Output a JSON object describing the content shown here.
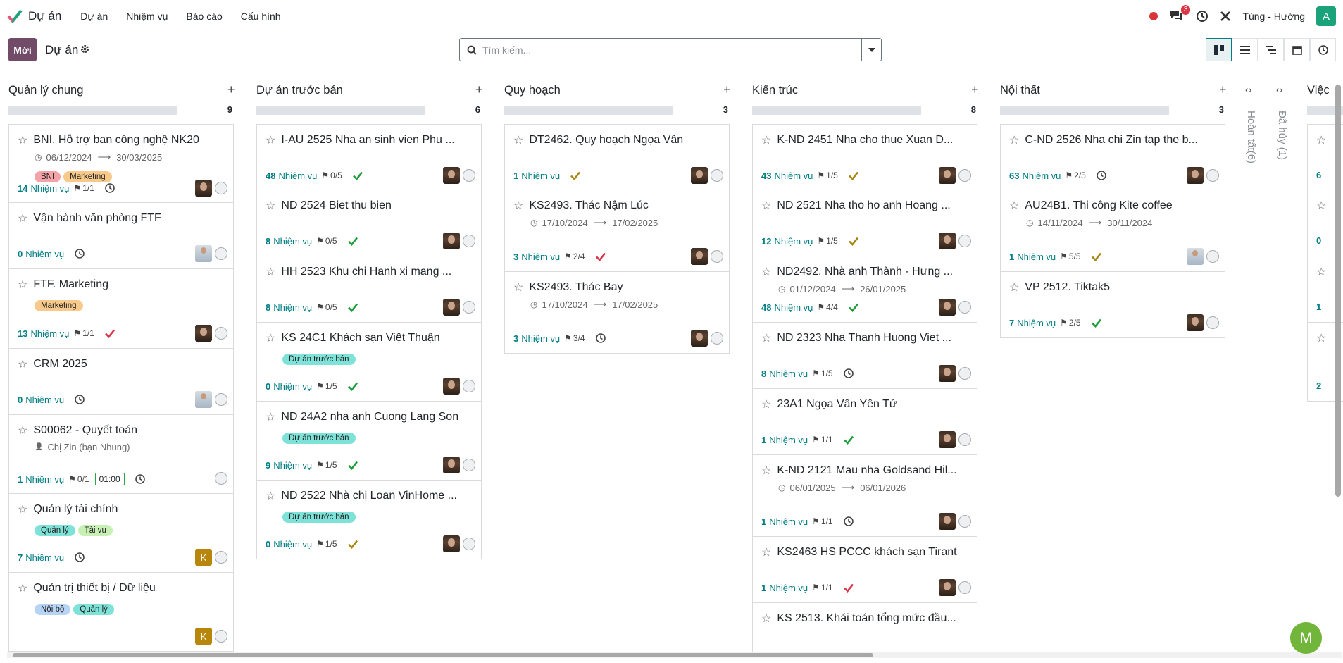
{
  "app": {
    "name": "Dự án",
    "menu": [
      "Dự án",
      "Nhiệm vụ",
      "Báo cáo",
      "Cấu hình"
    ],
    "user": "Tùng - Hường",
    "user_initial": "A",
    "messages_count": "3"
  },
  "control": {
    "new_label": "Mới",
    "breadcrumb": "Dự án",
    "search_placeholder": "Tìm kiếm..."
  },
  "colors": {
    "accent": "#017e84",
    "primary": "#714b67"
  },
  "columns": [
    {
      "title": "Quản lý chung",
      "count": "9",
      "cards": [
        {
          "title": "BNI. Hỗ trợ ban công nghệ NK20",
          "dates": [
            "06/12/2024",
            "30/03/2025"
          ],
          "tags": [
            {
              "label": "BNI",
              "color": "#f4a3a8"
            },
            {
              "label": "Marketing",
              "color": "#f7c98b"
            }
          ],
          "tasks": "14",
          "task_label": "Nhiệm vụ",
          "milestone": "1/1",
          "state": "clock",
          "avatar": "photo",
          "height": 112
        },
        {
          "title": "Vận hành văn phòng FTF",
          "tasks": "0",
          "task_label": "Nhiệm vụ",
          "state": "clock",
          "avatar": "man",
          "height": 94
        },
        {
          "title": "FTF. Marketing",
          "tags": [
            {
              "label": "Marketing",
              "color": "#f7c98b"
            }
          ],
          "tasks": "13",
          "task_label": "Nhiệm vụ",
          "milestone": "1/1",
          "state": "check-red",
          "avatar": "photo",
          "height": 113
        },
        {
          "title": "CRM 2025",
          "tasks": "0",
          "task_label": "Nhiệm vụ",
          "state": "clock",
          "avatar": "man",
          "height": 94
        },
        {
          "title": "S00062 - Quyết toán",
          "partner": "Chị Zin (bạn Nhung)",
          "tasks": "1",
          "task_label": "Nhiệm vụ",
          "milestone": "0/1",
          "timer": "01:00",
          "state": "clock",
          "avatar": "",
          "height": 112
        },
        {
          "title": "Quản lý tài chính",
          "tags": [
            {
              "label": "Quản lý",
              "color": "#7ee2d8"
            },
            {
              "label": "Tài vụ",
              "color": "#c8f0b4"
            }
          ],
          "tasks": "7",
          "task_label": "Nhiệm vụ",
          "state": "clock",
          "avatar": "K",
          "height": 112
        },
        {
          "title": "Quản trị thiết bị / Dữ liệu",
          "tags": [
            {
              "label": "Nội bộ",
              "color": "#b8d4f4"
            },
            {
              "label": "Quản lý",
              "color": "#7ee2d8"
            }
          ],
          "tasks": "",
          "task_label": "",
          "state": "",
          "avatar": "K",
          "height": 112
        }
      ]
    },
    {
      "title": "Dự án trước bán",
      "count": "6",
      "cards": [
        {
          "title": "I-AU 2525 Nha an sinh vien Phu ...",
          "tasks": "48",
          "task_label": "Nhiệm vụ",
          "milestone": "0/5",
          "state": "check-green",
          "avatar": "photo",
          "height": 94
        },
        {
          "title": "ND 2524 Biet thu bien",
          "tasks": "8",
          "task_label": "Nhiệm vụ",
          "milestone": "0/5",
          "state": "check-green",
          "avatar": "photo",
          "height": 94
        },
        {
          "title": "HH 2523 Khu chi Hanh xi mang ...",
          "tasks": "8",
          "task_label": "Nhiệm vụ",
          "milestone": "0/5",
          "state": "check-green",
          "avatar": "photo",
          "height": 94
        },
        {
          "title": "KS 24C1 Khách sạn Việt Thuận",
          "tags": [
            {
              "label": "Dự án trước bán",
              "color": "#7ee2d8"
            }
          ],
          "tasks": "0",
          "task_label": "Nhiệm vụ",
          "milestone": "1/5",
          "state": "check-green",
          "avatar": "photo",
          "height": 112
        },
        {
          "title": "ND 24A2 nha anh Cuong Lang Son",
          "tags": [
            {
              "label": "Dự án trước bán",
              "color": "#7ee2d8"
            }
          ],
          "tasks": "9",
          "task_label": "Nhiệm vụ",
          "milestone": "1/5",
          "state": "check-green",
          "avatar": "photo",
          "height": 112
        },
        {
          "title": "ND 2522 Nhà chị Loan VinHome ...",
          "tags": [
            {
              "label": "Dự án trước bán",
              "color": "#7ee2d8"
            }
          ],
          "tasks": "0",
          "task_label": "Nhiệm vụ",
          "milestone": "1/5",
          "state": "check-olive",
          "avatar": "photo",
          "height": 112
        }
      ]
    },
    {
      "title": "Quy hoạch",
      "count": "3",
      "cards": [
        {
          "title": "DT2462. Quy hoạch Ngọa Vân",
          "tasks": "1",
          "task_label": "Nhiệm vụ",
          "state": "check-olive",
          "avatar": "photo",
          "height": 94
        },
        {
          "title": "KS2493. Thác Nậm Lúc",
          "dates": [
            "17/10/2024",
            "17/02/2025"
          ],
          "tasks": "3",
          "task_label": "Nhiệm vụ",
          "milestone": "2/4",
          "state": "check-red",
          "avatar": "photo",
          "height": 116
        },
        {
          "title": "KS2493. Thác Bay",
          "dates": [
            "17/10/2024",
            "17/02/2025"
          ],
          "tasks": "3",
          "task_label": "Nhiệm vụ",
          "milestone": "3/4",
          "state": "clock",
          "avatar": "photo",
          "height": 116
        }
      ]
    },
    {
      "title": "Kiến trúc",
      "count": "8",
      "cards": [
        {
          "title": "K-ND 2451 Nha cho thue Xuan D...",
          "tasks": "43",
          "task_label": "Nhiệm vụ",
          "milestone": "1/5",
          "state": "check-olive",
          "avatar": "photo",
          "height": 94
        },
        {
          "title": "ND 2521 Nha tho ho anh Hoang ...",
          "tasks": "12",
          "task_label": "Nhiệm vụ",
          "milestone": "1/5",
          "state": "check-olive",
          "avatar": "photo",
          "height": 94
        },
        {
          "title": "ND2492. Nhà anh Thành - Hưng ...",
          "dates": [
            "01/12/2024",
            "26/01/2025"
          ],
          "tasks": "48",
          "task_label": "Nhiệm vụ",
          "milestone": "4/4",
          "state": "check-green",
          "avatar": "photo",
          "height": 94
        },
        {
          "title": "ND 2323 Nha Thanh Huong Viet ...",
          "tasks": "8",
          "task_label": "Nhiệm vụ",
          "milestone": "1/5",
          "state": "clock",
          "avatar": "photo",
          "height": 94
        },
        {
          "title": "23A1 Ngọa Vân Yên Tử",
          "tasks": "1",
          "task_label": "Nhiệm vụ",
          "milestone": "1/1",
          "state": "check-green",
          "avatar": "photo",
          "height": 94
        },
        {
          "title": "K-ND 2121 Mau nha Goldsand Hil...",
          "dates": [
            "06/01/2025",
            "06/01/2026"
          ],
          "tasks": "1",
          "task_label": "Nhiệm vụ",
          "milestone": "1/1",
          "state": "clock",
          "avatar": "photo",
          "height": 116
        },
        {
          "title": "KS2463 HS PCCC khách sạn Tirant",
          "tasks": "1",
          "task_label": "Nhiệm vụ",
          "milestone": "1/1",
          "state": "check-red",
          "avatar": "photo",
          "height": 94
        },
        {
          "title": "KS 2513. Khái toán tổng mức đầu...",
          "tasks": "",
          "task_label": "",
          "state": "",
          "avatar": "",
          "height": 94
        }
      ]
    },
    {
      "title": "Nội thất",
      "count": "3",
      "cards": [
        {
          "title": "C-ND 2526 Nha chi Zin tap the b...",
          "tasks": "63",
          "task_label": "Nhiệm vụ",
          "milestone": "2/5",
          "state": "clock",
          "avatar": "photo",
          "height": 94
        },
        {
          "title": "AU24B1. Thi công Kite coffee",
          "dates": [
            "14/11/2024",
            "30/11/2024"
          ],
          "tasks": "1",
          "task_label": "Nhiệm vụ",
          "milestone": "5/5",
          "state": "check-olive",
          "avatar": "man",
          "height": 116
        },
        {
          "title": "VP 2512. Tiktak5",
          "tasks": "7",
          "task_label": "Nhiệm vụ",
          "milestone": "2/5",
          "state": "check-green",
          "avatar": "photo",
          "height": 94
        }
      ]
    }
  ],
  "folded": [
    {
      "title": "Hoàn tất(6)"
    },
    {
      "title": "Đã hủy (1)"
    }
  ],
  "partial_column": {
    "title": "Việc",
    "counts": [
      "6",
      "0",
      "1",
      "2"
    ]
  },
  "fab": {
    "label": "M"
  }
}
